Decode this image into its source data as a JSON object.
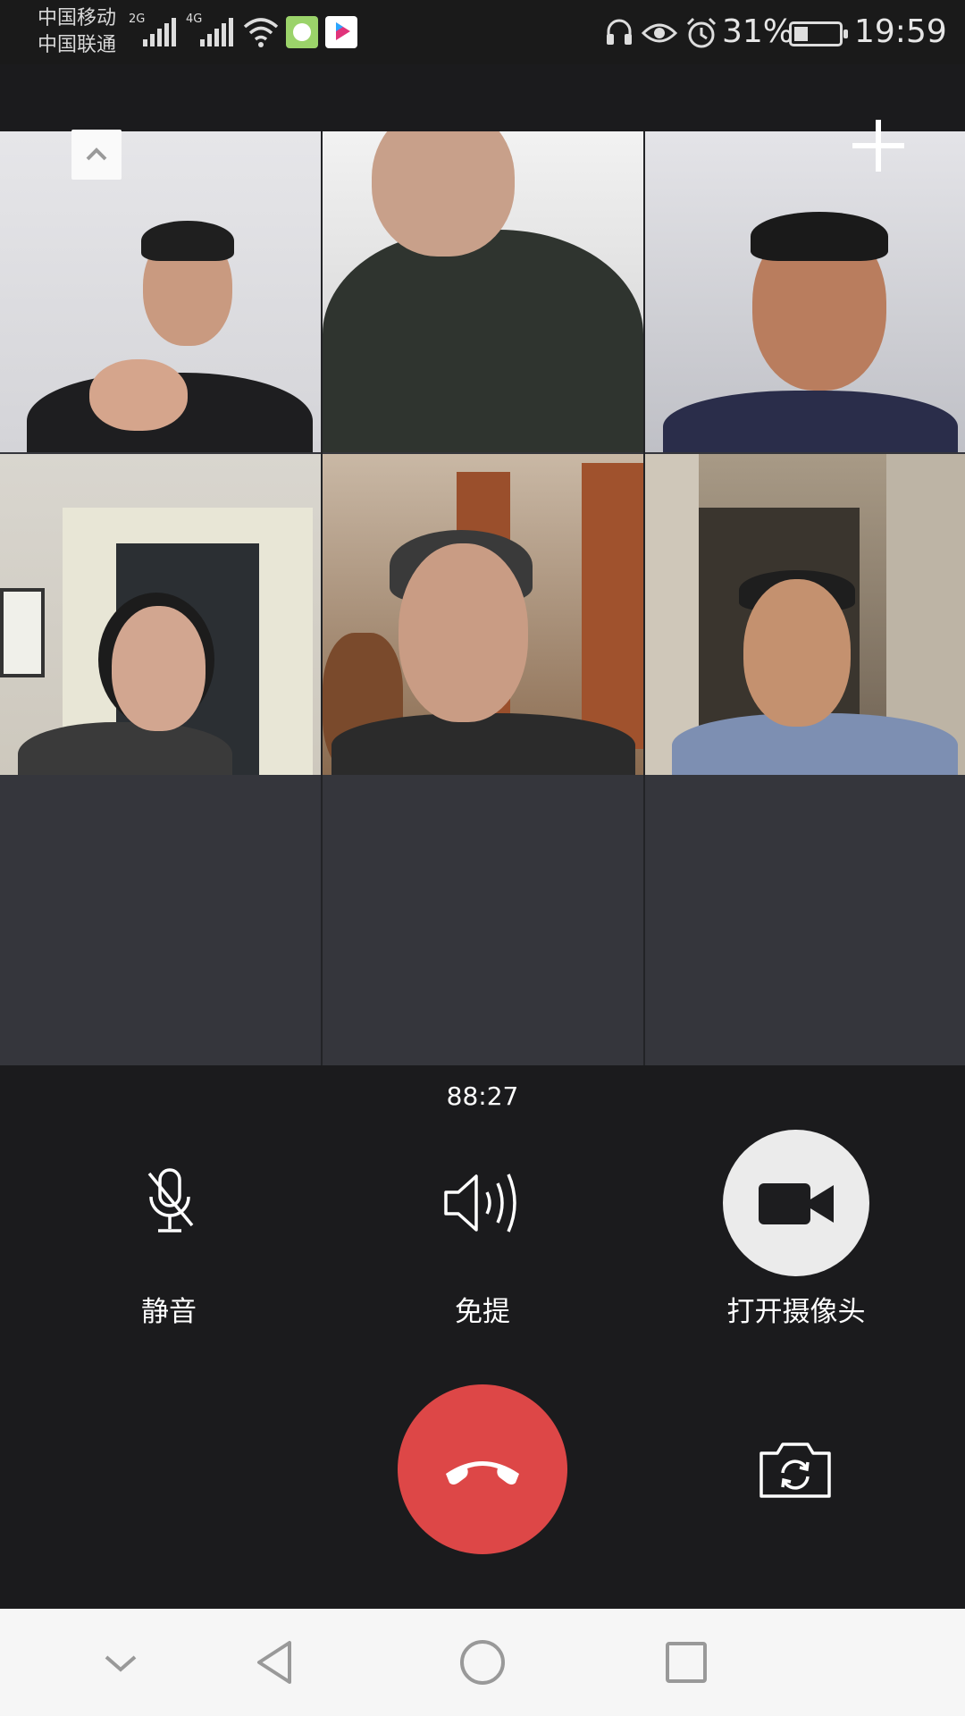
{
  "status_bar": {
    "carrier_1": "中国移动",
    "carrier_2": "中国联通",
    "network_1": "2G",
    "network_2": "4G",
    "battery": "31%",
    "battery_level": 0.31,
    "time": "19:59",
    "icons": [
      "signal-icon",
      "wifi-icon",
      "app-notification-icon",
      "youku-icon",
      "headset-icon",
      "eye-icon",
      "alarm-icon",
      "battery-icon"
    ]
  },
  "call": {
    "duration": "88:27",
    "participant_count": 6
  },
  "controls": {
    "mute_label": "静音",
    "speaker_label": "免提",
    "camera_label": "打开摄像头"
  },
  "colors": {
    "background": "#1b1b1d",
    "grid_background": "#35363c",
    "hangup": "#dd4747",
    "camera_button": "#ebebeb",
    "nav_bar": "#f6f6f6"
  }
}
